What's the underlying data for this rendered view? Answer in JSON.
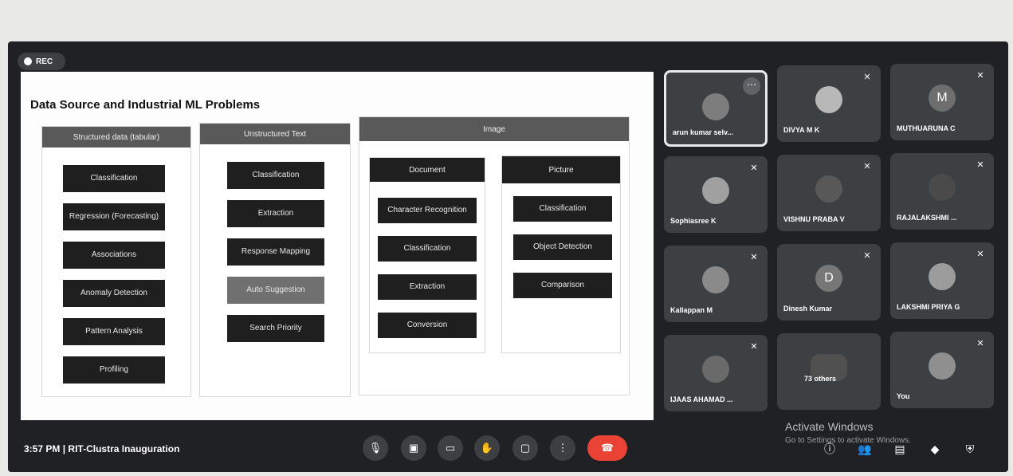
{
  "rec_label": "REC",
  "slide": {
    "title": "Data Source and Industrial ML Problems",
    "structured": {
      "header": "Structured data (tabular)",
      "items": [
        "Classification",
        "Regression (Forecasting)",
        "Associations",
        "Anomaly Detection",
        "Pattern Analysis",
        "Profiling"
      ]
    },
    "unstructured": {
      "header": "Unstructured Text",
      "items": [
        "Classification",
        "Extraction",
        "Response Mapping",
        "Auto Suggestion",
        "Search Priority"
      ]
    },
    "image": {
      "header": "Image",
      "document": {
        "header": "Document",
        "items": [
          "Character Recognition",
          "Classification",
          "Extraction",
          "Conversion"
        ]
      },
      "picture": {
        "header": "Picture",
        "items": [
          "Classification",
          "Object Detection",
          "Comparison"
        ]
      }
    }
  },
  "participants": [
    {
      "name": "arun kumar selv...",
      "avatar": ""
    },
    {
      "name": "DIVYA M K",
      "avatar": ""
    },
    {
      "name": "MUTHUARUNA C",
      "avatar": "M"
    },
    {
      "name": "Sophiasree K",
      "avatar": ""
    },
    {
      "name": "VISHNU PRABA V",
      "avatar": ""
    },
    {
      "name": "RAJALAKSHMI ...",
      "avatar": ""
    },
    {
      "name": "Kallappan M",
      "avatar": ""
    },
    {
      "name": "Dinesh Kumar",
      "avatar": "D"
    },
    {
      "name": "LAKSHMI PRIYA G",
      "avatar": ""
    },
    {
      "name": "IJAAS AHAMAD ...",
      "avatar": ""
    },
    {
      "name": "73 others",
      "avatar": ""
    },
    {
      "name": "You",
      "avatar": ""
    }
  ],
  "footer": {
    "time": "3:57 PM",
    "separator": "|",
    "meeting": "RIT-Clustra Inauguration"
  },
  "watermark": {
    "title": "Activate Windows",
    "subtitle": "Go to Settings to activate Windows."
  },
  "colors": {
    "end_call": "#ea4335",
    "tile_bg": "#3c4043",
    "screen_bg": "#202124"
  }
}
